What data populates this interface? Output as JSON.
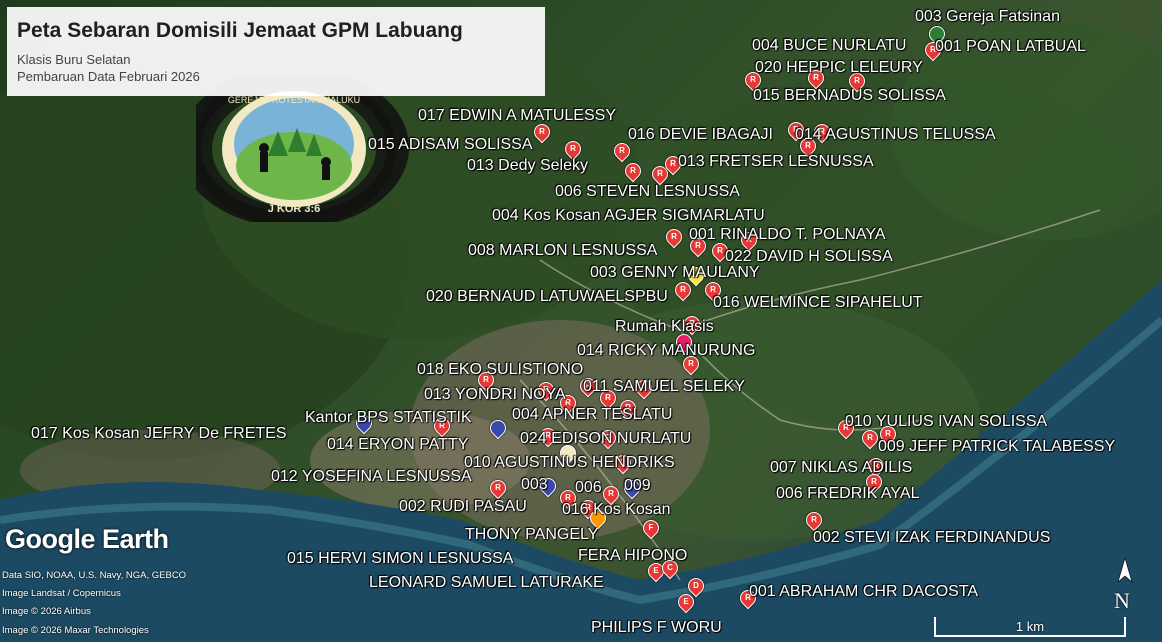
{
  "title": "Peta Sebaran Domisili Jemaat GPM Labuang",
  "subtitle": "Klasis Buru Selatan",
  "update": "Pembaruan Data Februari 2026",
  "logo_ring_text": "GEREJA PROTESTAN MALUKU",
  "logo_ring_bottom": "J KOR 3:6",
  "ge_logo": "Google Earth",
  "credits": [
    "Data SIO, NOAA, U.S. Navy, NGA, GEBCO",
    "Image Landsat / Copernicus",
    "Image © 2026 Airbus",
    "Image © 2026 Maxar Technologies"
  ],
  "scale_label": "1 km",
  "north_label": "N",
  "colors": {
    "pin": "#e53935",
    "church": "#2e7d32",
    "home": "#f9e535",
    "office": "#3949ab",
    "klasis": "#e91e63"
  },
  "labels": [
    "003 Gereja Fatsinan",
    "004 BUCE NURLATU",
    "001 POAN LATBUAL",
    "020 HEPPIC LELEURY",
    "015  BERNADUS SOLISSA",
    "017 EDWIN A MATULESSY",
    "016 DEVIE IBAGAJI",
    "014 AGUSTINUS TELUSSA",
    "015 ADISAM SOLISSA",
    "013 Dedy Seleky",
    "013 FRETSER LESNUSSA",
    "006 STEVEN LESNUSSA",
    "004 Kos Kosan AGJER SIGMARLATU",
    "001 RINALDO T. POLNAYA",
    "008 MARLON LESNUSSA",
    "022 DAVID H SOLISSA",
    "003 GENNY  MAULANY",
    "020 BERNAUD LATUWAELSPBU",
    "016 WELMINCE SIPAHELUT",
    "Rumah Klasis",
    "014 RICKY  MANURUNG",
    "018 EKO SULISTIONO",
    "011 SAMUEL SELEKY",
    "013 YONDRI NOYA",
    "Kantor BPS STATISTIK",
    "004 APNER TESLATU",
    "010 YULIUS IVAN SOLISSA",
    "017 Kos Kosan JEFRY De FRETES",
    "014 ERYON PATTY",
    "024 EDISON NURLATU",
    "009 JEFF PATRICK TALABESSY",
    "010 AGUSTINUS HENDRIKS",
    "007 NIKLAS ADILIS",
    "012 YOSEFINA LESNUSSA",
    "003",
    "006",
    "009",
    "006 FREDRIK AYAL",
    "002 RUDI PASAU",
    "016 Kos Kosan",
    "THONY PANGELY",
    "002 STEVI IZAK FERDINANDUS",
    "FERA HIPONO",
    "015 HERVI SIMON LESNUSSA",
    "LEONARD  SAMUEL  LATURAKE",
    "001 ABRAHAM CHR DACOSTA",
    "PHILIPS  F WORU"
  ]
}
